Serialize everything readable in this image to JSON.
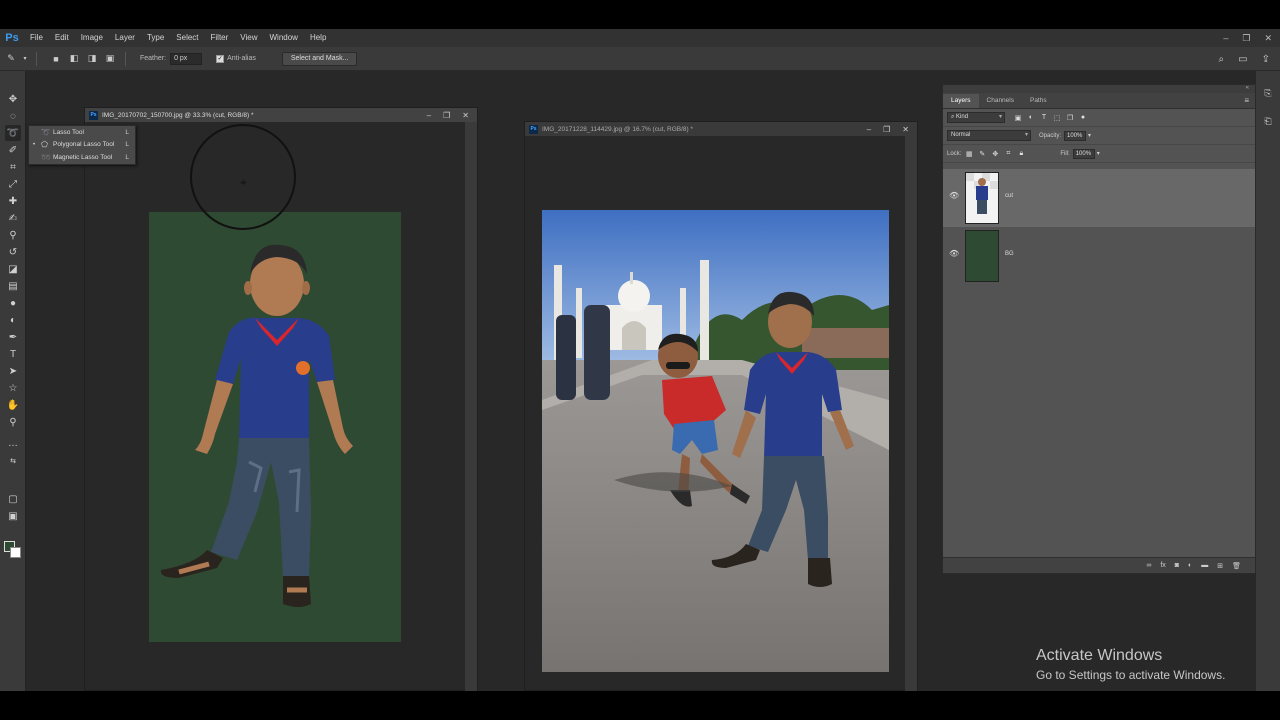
{
  "app": {
    "logo": "Ps"
  },
  "menu": {
    "items": [
      "File",
      "Edit",
      "Image",
      "Layer",
      "Type",
      "Select",
      "Filter",
      "View",
      "Window",
      "Help"
    ]
  },
  "window_controls": {
    "minimize": "–",
    "restore": "❐",
    "close": "✕"
  },
  "options_bar": {
    "feather_label": "Feather:",
    "feather_value": "0 px",
    "antialias_label": "Anti-alias",
    "antialias_checked": true,
    "select_mask_label": "Select and Mask..."
  },
  "tool_flyout": {
    "items": [
      {
        "label": "Lasso Tool",
        "shortcut": "L",
        "selected": false
      },
      {
        "label": "Polygonal Lasso Tool",
        "shortcut": "L",
        "selected": true
      },
      {
        "label": "Magnetic Lasso Tool",
        "shortcut": "L",
        "selected": false
      }
    ]
  },
  "colors": {
    "foreground": "#2f4a33",
    "background": "#ffffff",
    "accent": "#3a9cf0"
  },
  "documents": [
    {
      "title": "IMG_20170702_150700.jpg @ 33.3% (cut, RGB/8) *",
      "active": true
    },
    {
      "title": "IMG_20171228_114429.jpg @ 16.7% (cut, RGB/8) *",
      "active": false
    }
  ],
  "layers_panel": {
    "tabs": [
      "Layers",
      "Channels",
      "Paths"
    ],
    "active_tab": "Layers",
    "filter_kind": "Kind",
    "blend_mode": "Normal",
    "opacity_label": "Opacity:",
    "opacity_value": "100%",
    "lock_label": "Lock:",
    "fill_label": "Fill:",
    "fill_value": "100%",
    "layers": [
      {
        "name": "cut",
        "visible": true,
        "selected": true
      },
      {
        "name": "BG",
        "visible": true,
        "selected": false
      }
    ]
  },
  "watermark": {
    "title": "Activate Windows",
    "subtitle": "Go to Settings to activate Windows."
  }
}
